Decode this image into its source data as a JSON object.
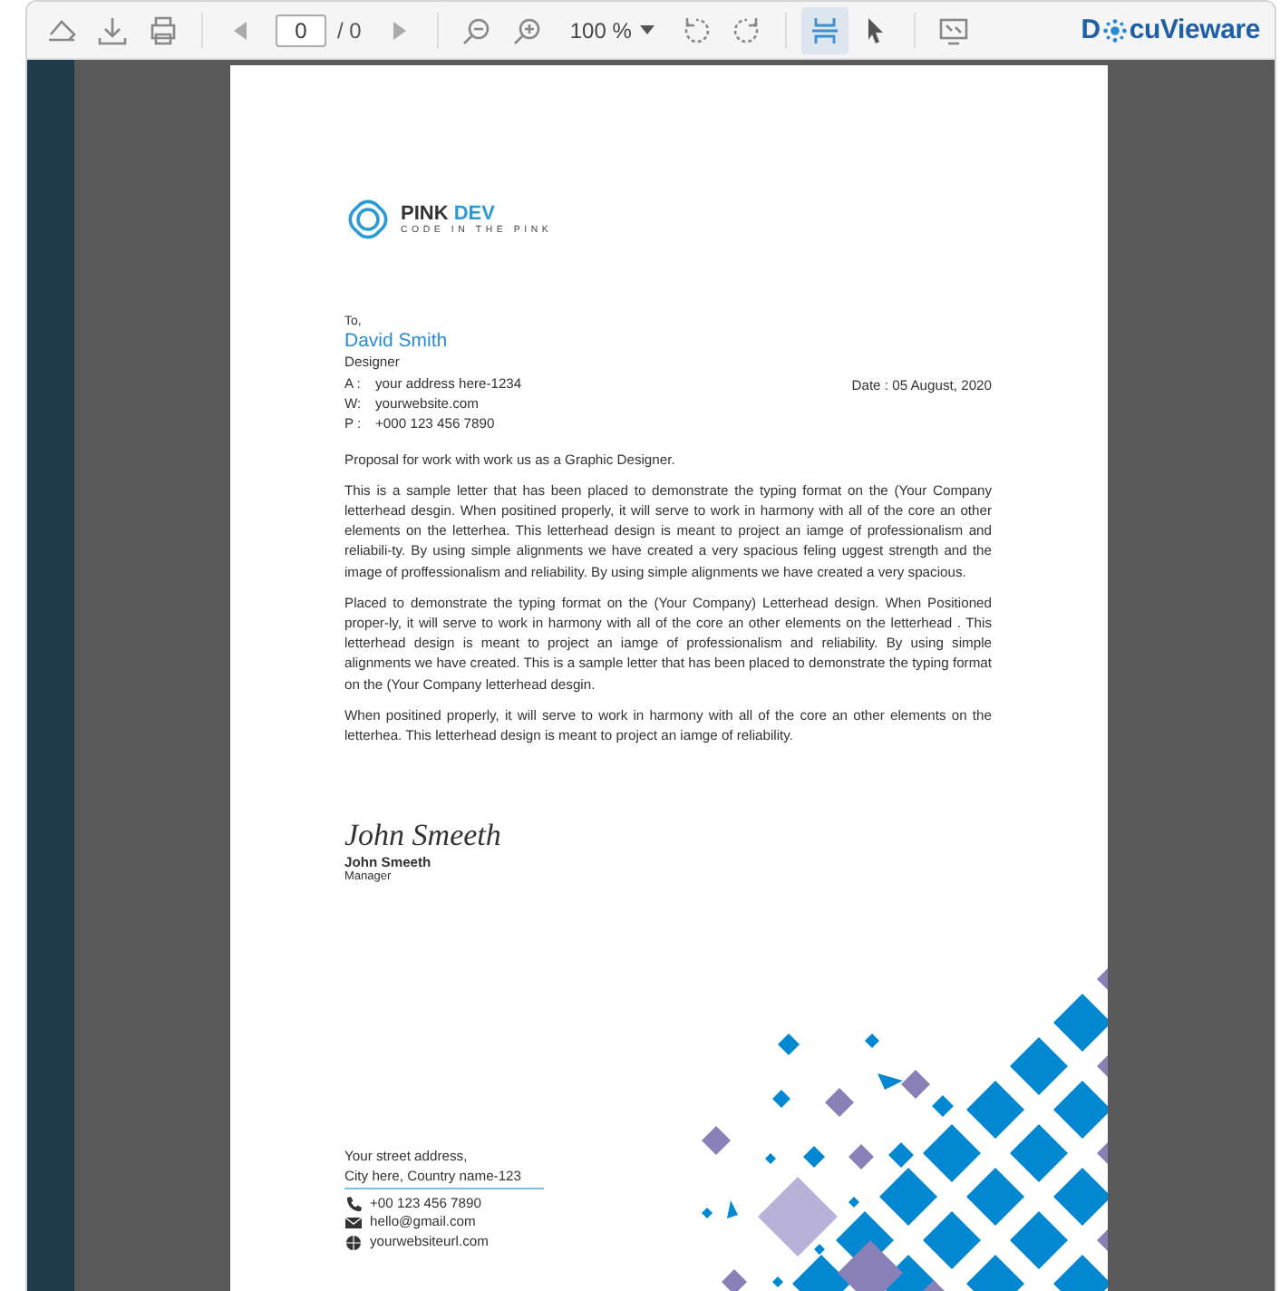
{
  "toolbar": {
    "groups": [
      [
        {
          "kind": "eraser"
        },
        {
          "kind": "download"
        },
        {
          "kind": "print"
        }
      ],
      [
        {
          "kind": "prev"
        },
        {
          "kind": "page-field",
          "value": "0"
        },
        {
          "kind": "page-count",
          "text": "/ 0"
        },
        {
          "kind": "next"
        }
      ],
      [
        {
          "kind": "zoom-out"
        },
        {
          "kind": "zoom-in"
        },
        {
          "kind": "zoom-select",
          "text": "100 %"
        },
        {
          "kind": "rotate-left"
        },
        {
          "kind": "rotate-right"
        }
      ],
      [
        {
          "kind": "fit-page",
          "selected": true
        },
        {
          "kind": "pointer",
          "selected": false
        }
      ],
      [
        {
          "kind": "fullscreen"
        }
      ]
    ],
    "logo": {
      "before": "D",
      "after": "cuVieware"
    }
  },
  "letter": {
    "logo": {
      "name_bold": "PINK",
      "name_light": "DEV",
      "tagline": "CODE IN THE PINK"
    },
    "recipient": {
      "salutation": "To,",
      "name": "David Smith",
      "role": "Designer"
    },
    "contacts": [
      {
        "label": "A :",
        "value": "your address here-1234"
      },
      {
        "label": "W:",
        "value": "yourwebsite.com"
      },
      {
        "label": "P :",
        "value": "+000 123 456 7890"
      }
    ],
    "date": "Date : 05 August, 2020",
    "subject": "Proposal for work with work us as a Graphic Designer.",
    "paragraphs": [
      "This is a sample letter that has been placed to demonstrate the typing format on the (Your Company letterhead desgin. When positined properly, it will serve to work in harmony with all of the core an other elements on the letterhea. This letterhead design is meant to project an iamge of professionalism and reliabili-ty. By using simple alignments we have created a very spacious feling uggest strength and the image of proffessionalism and reliability. By using simple alignments we have created a very spacious.",
      "Placed to demonstrate the typing format on the (Your Company) Letterhead design. When Positioned proper-ly, it will serve to work in harmony with all of the core an other elements on the letterhead . This letterhead design is meant to project an iamge of professionalism and reliability. By using simple alignments we have created. This is a sample letter that has been placed to demonstrate the typing format on the (Your Company letterhead desgin.",
      "When positined properly, it will serve to work in harmony with all of the core an other elements on the letterhea. This letterhead design is meant to project an iamge of reliability."
    ],
    "signature": {
      "script": "John Smeeth",
      "name": "John Smeeth",
      "title": "Manager"
    },
    "footer": {
      "address": [
        "Your street address,",
        "City here, Country name-123"
      ],
      "contacts": [
        {
          "kind": "phone",
          "text": "+00 123 456 7890"
        },
        {
          "kind": "email",
          "text": "hello@gmail.com"
        },
        {
          "kind": "web",
          "text": "yourwebsiteurl.com"
        }
      ]
    }
  }
}
